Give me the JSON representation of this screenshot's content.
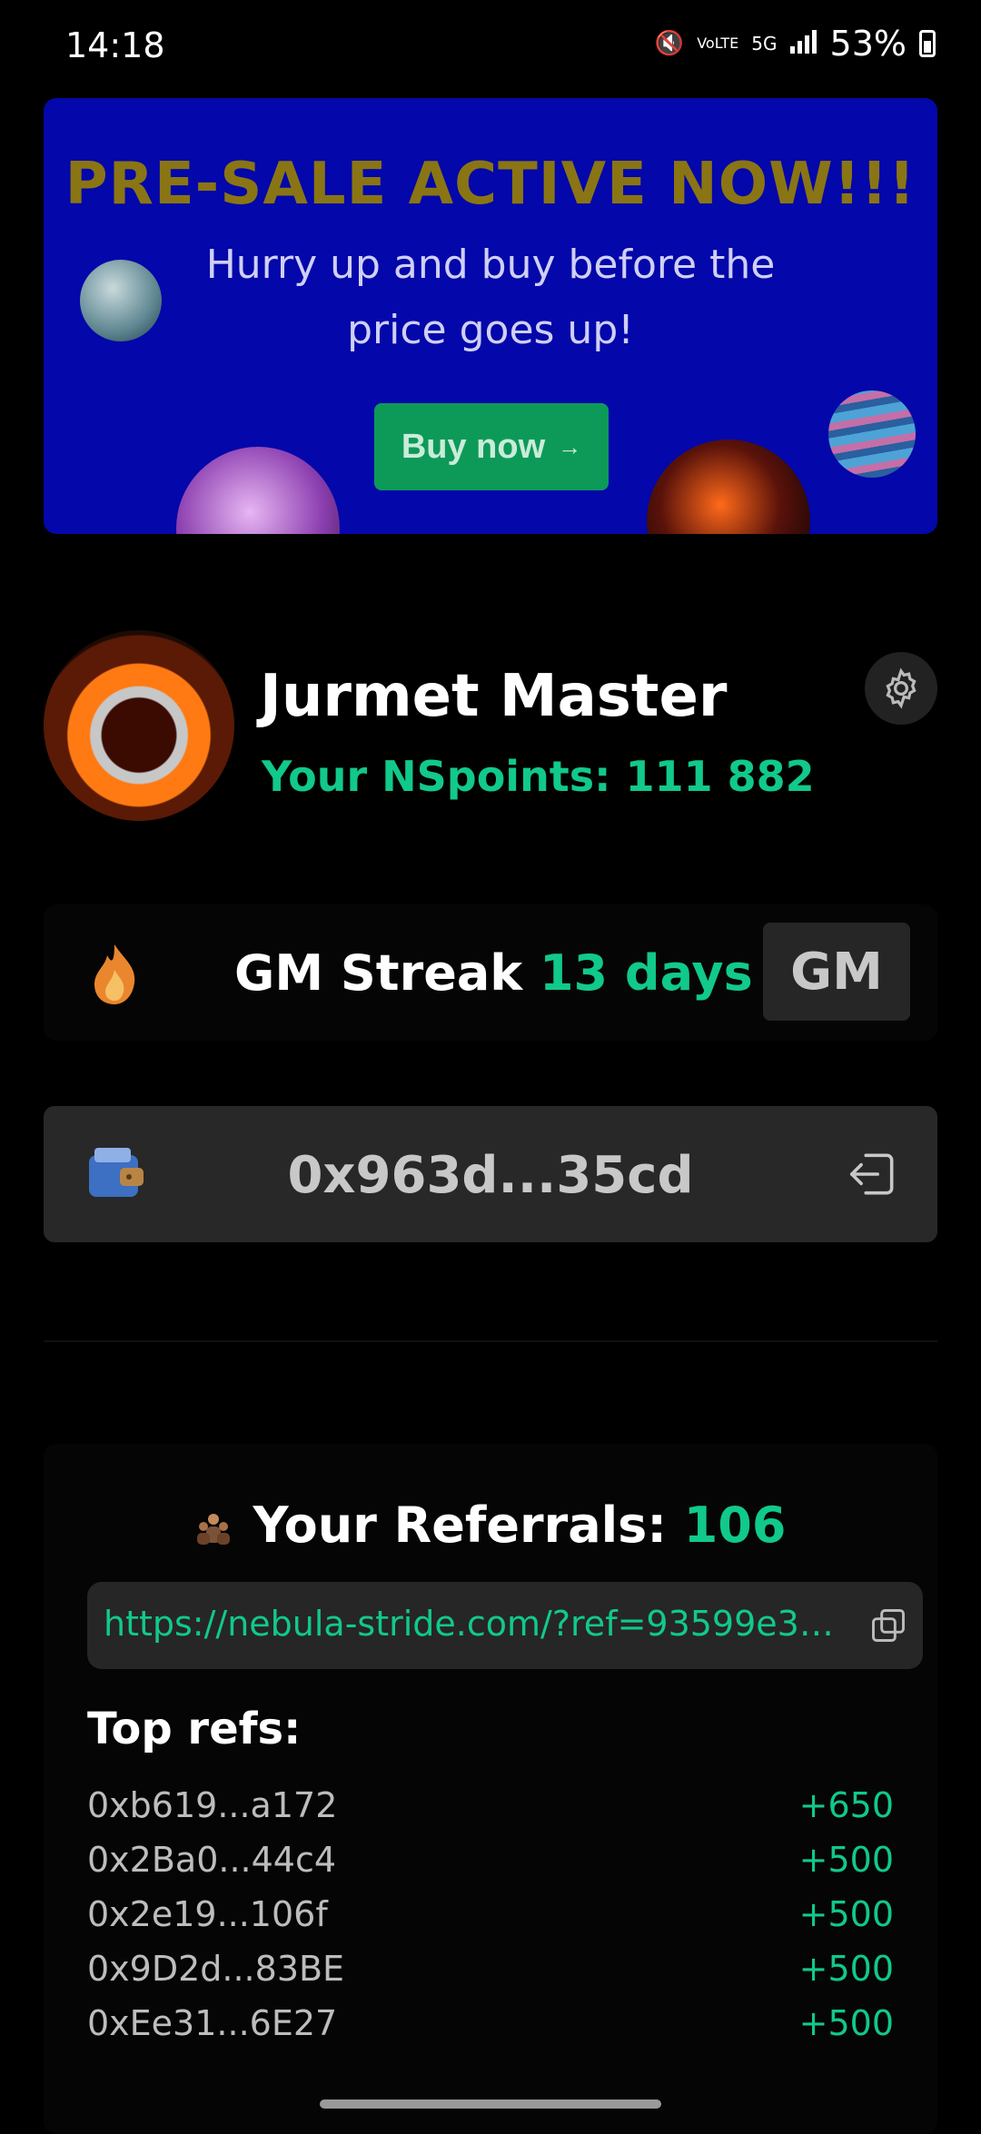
{
  "status_bar": {
    "time": "14:18",
    "battery": "53%",
    "network_volte": "VoLTE",
    "network_5g": "5G"
  },
  "banner": {
    "title": "PRE-SALE ACTIVE NOW!!!",
    "subtitle": "Hurry up and buy before the price goes up!",
    "button_label": "Buy now",
    "button_arrow": "→",
    "colors": {
      "background": "#0407a9",
      "title": "#8a7514",
      "button": "#0d9a58"
    }
  },
  "profile": {
    "name": "Jurmet Master",
    "points_label": "Your NSpoints: 111 882"
  },
  "streak": {
    "label": "GM Streak",
    "value": "13 days",
    "button_label": "GM"
  },
  "wallet": {
    "address": "0x963d...35cd"
  },
  "referrals": {
    "title": "Your Referrals:",
    "count": "106",
    "link": "https://nebula-stride.com/?ref=93599e319b...",
    "top_label": "Top refs:",
    "top": [
      {
        "address": "0xb619...a172",
        "points": "+650"
      },
      {
        "address": "0x2Ba0...44c4",
        "points": "+500"
      },
      {
        "address": "0x2e19...106f",
        "points": "+500"
      },
      {
        "address": "0x9D2d...83BE",
        "points": "+500"
      },
      {
        "address": "0xEe31...6E27",
        "points": "+500"
      }
    ]
  },
  "icons": [
    "mute-icon",
    "volte-icon",
    "5g-icon",
    "signal-icon",
    "battery-icon",
    "settings-gear-icon",
    "flame-icon",
    "wallet-icon",
    "logout-icon",
    "people-icon",
    "copy-icon"
  ],
  "accent_color": "#11c98a"
}
